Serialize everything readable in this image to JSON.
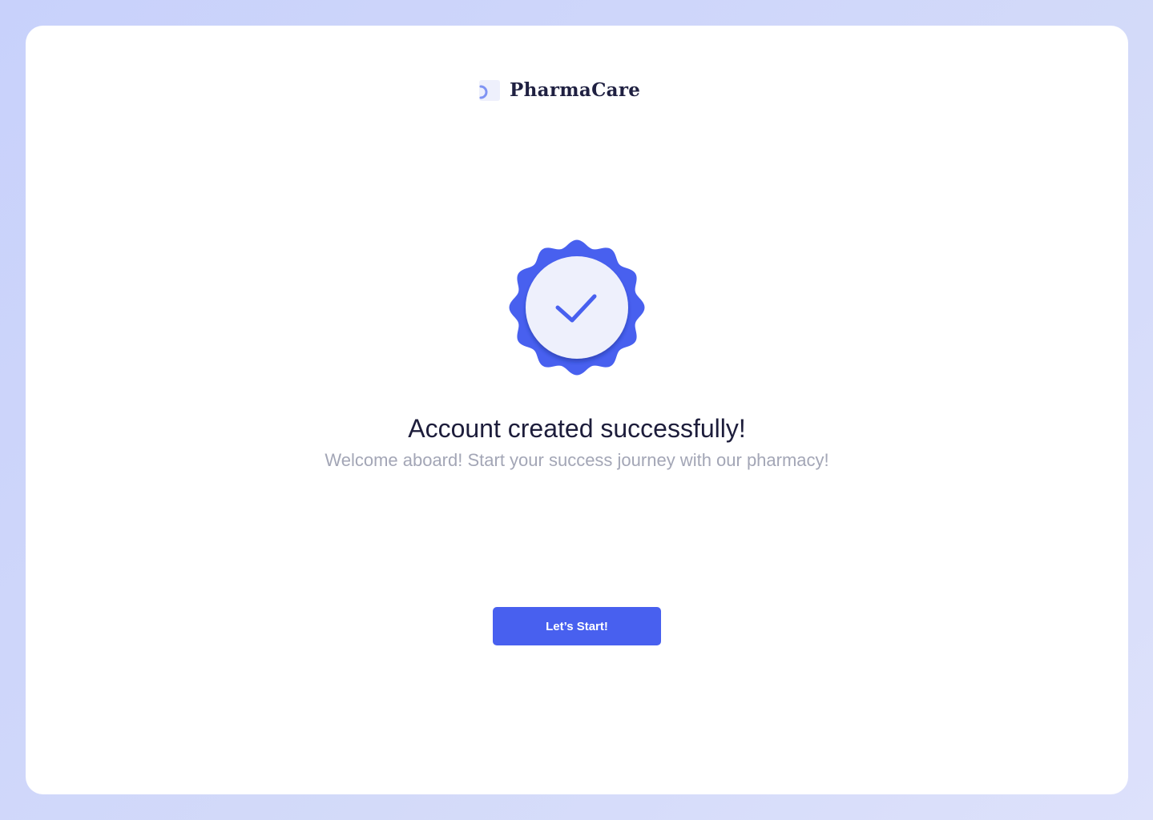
{
  "brand": {
    "name": "PharmaCare",
    "logo_icon": "pharmacare-logo-icon"
  },
  "success": {
    "badge_icon": "verified-badge-check-icon",
    "title": "Account created successfully!",
    "subtitle": "Welcome aboard! Start your success journey with our pharmacy!"
  },
  "actions": {
    "start_label": "Let’s Start!"
  },
  "colors": {
    "accent": "#4860ef",
    "badge_inner": "#eef0fc",
    "title_text": "#1d1d3b",
    "subtitle_text": "#a3a6b6",
    "background": "#c8d1fb"
  }
}
